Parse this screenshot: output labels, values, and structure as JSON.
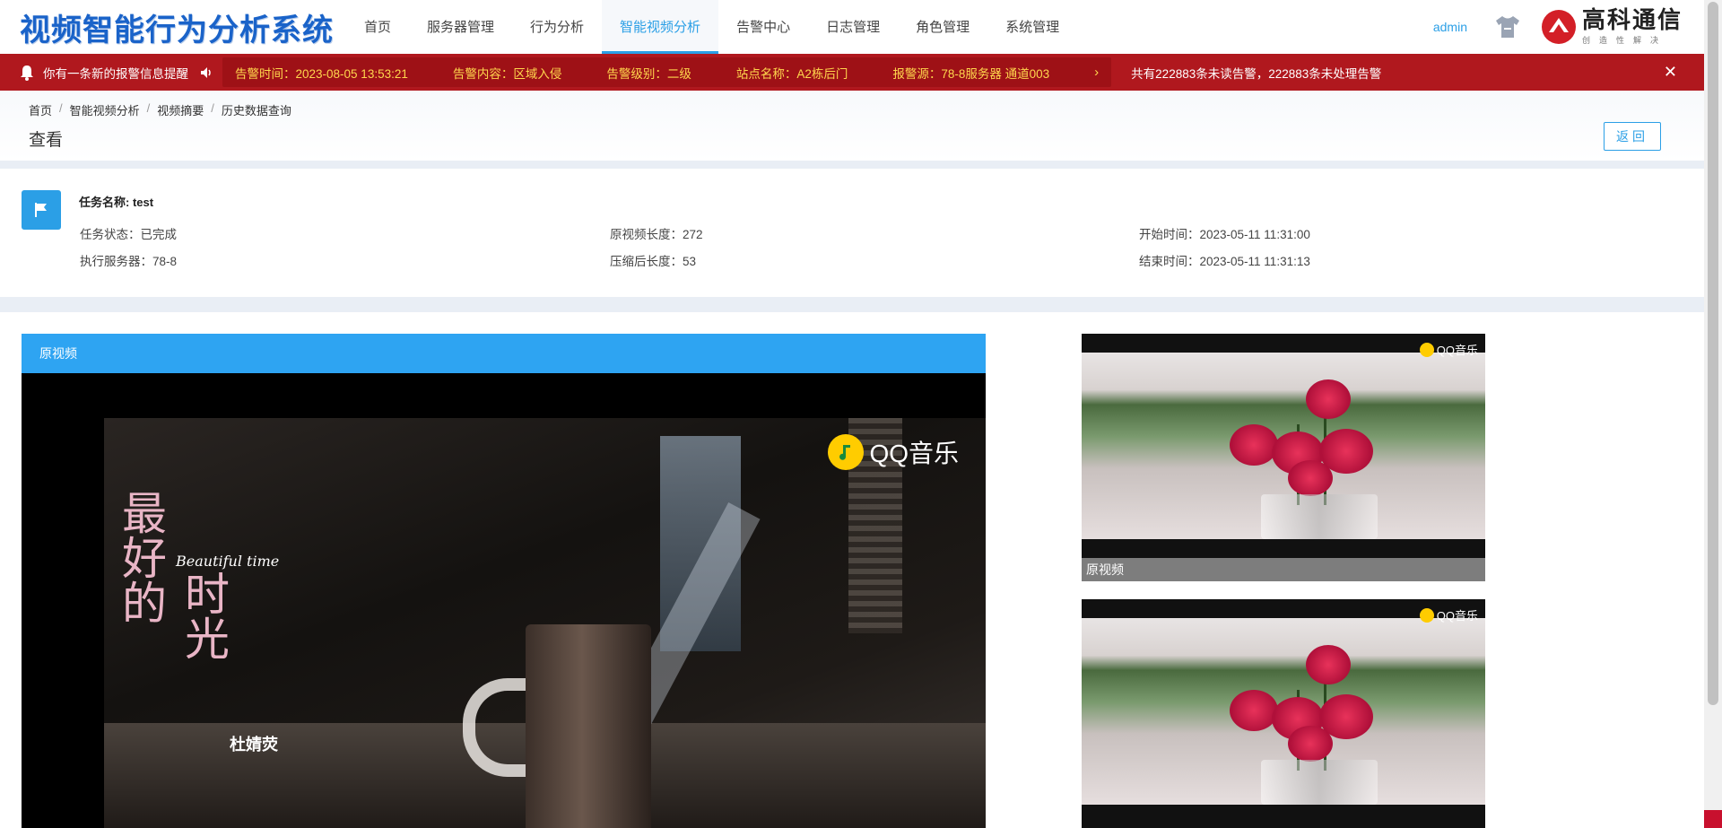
{
  "app": {
    "title": "视频智能行为分析系统"
  },
  "nav": {
    "items": [
      {
        "label": "首页"
      },
      {
        "label": "服务器管理"
      },
      {
        "label": "行为分析"
      },
      {
        "label": "智能视频分析",
        "active": true
      },
      {
        "label": "告警中心"
      },
      {
        "label": "日志管理"
      },
      {
        "label": "角色管理"
      },
      {
        "label": "系统管理"
      }
    ],
    "username": "admin",
    "icons": [
      "shirt-icon"
    ],
    "logo": {
      "name": "高科通信",
      "tagline": "创造性解决"
    }
  },
  "alarm": {
    "title": "你有一条新的报警信息提醒",
    "time": "告警时间：2023-08-05 13:53:21",
    "content": "告警内容：区域入侵",
    "level": "告警级别：二级",
    "site": "站点名称：A2栋后门",
    "source": "报警源：78-8服务器 通道003",
    "summary": "共有222883条未读告警，222883条未处理告警",
    "close_icon": "close-icon",
    "colors": {
      "bar": "#b0181e",
      "highlight": "#ffd64d"
    }
  },
  "breadcrumb": [
    "首页",
    "智能视频分析",
    "视频摘要",
    "历史数据查询"
  ],
  "page": {
    "title": "查看",
    "back_label": "返回"
  },
  "task": {
    "name": "任务名称: test",
    "status": "任务状态：已完成",
    "server": "执行服务器：78-8",
    "original_length": "原视频长度：272",
    "compressed_length": "压缩后长度：53",
    "start_time": "开始时间：2023-05-11 11:31:00",
    "end_time": "结束时间：2023-05-11 11:31:13"
  },
  "videos": {
    "main_header": "原视频",
    "main_overlay": {
      "qq_music": "QQ音乐",
      "poem_line1": "最好的",
      "poem_line2": "时光",
      "script": "Beautiful time",
      "singer": "杜婧荧"
    },
    "thumbs": [
      {
        "caption": "原视频",
        "qq_music": "QQ音乐"
      },
      {
        "caption": "",
        "qq_music": "QQ音乐"
      }
    ]
  },
  "accent_color": "#2b9fe6"
}
